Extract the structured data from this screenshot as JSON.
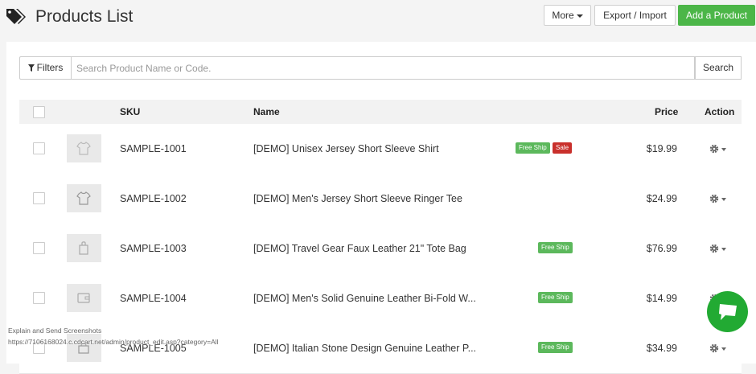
{
  "header": {
    "title": "Products List",
    "more_label": "More",
    "export_label": "Export / Import",
    "add_label": "Add a Product"
  },
  "search": {
    "filters_label": "Filters",
    "placeholder": "Search Product Name or Code.",
    "value": "",
    "search_label": "Search"
  },
  "table": {
    "headers": {
      "sku": "SKU",
      "name": "Name",
      "price": "Price",
      "action": "Action"
    },
    "rows": [
      {
        "sku": "SAMPLE-1001",
        "name": "[DEMO] Unisex Jersey Short Sleeve Shirt",
        "price": "$19.99",
        "badges": [
          "Free Ship",
          "Sale"
        ],
        "thumb_icon": "shirt-icon"
      },
      {
        "sku": "SAMPLE-1002",
        "name": "[DEMO] Men's Jersey Short Sleeve Ringer Tee",
        "price": "$24.99",
        "badges": [],
        "thumb_icon": "shirt-icon"
      },
      {
        "sku": "SAMPLE-1003",
        "name": "[DEMO] Travel Gear Faux Leather 21\" Tote Bag",
        "price": "$76.99",
        "badges": [
          "Free Ship"
        ],
        "thumb_icon": "bag-icon"
      },
      {
        "sku": "SAMPLE-1004",
        "name": "[DEMO] Men's Solid Genuine Leather Bi-Fold W...",
        "price": "$14.99",
        "badges": [
          "Free Ship"
        ],
        "thumb_icon": "wallet-icon"
      },
      {
        "sku": "SAMPLE-1005",
        "name": "[DEMO] Italian Stone Design Genuine Leather P...",
        "price": "$34.99",
        "badges": [
          "Free Ship"
        ],
        "thumb_icon": "purse-icon"
      }
    ]
  },
  "status": {
    "line1": "Explain and Send Screenshots",
    "line2": "https://7106168024.c.cdcart.net/admin/product_edit.asp?category=All"
  },
  "colors": {
    "primary_green": "#4cb648",
    "badge_free_ship": "#5cb85c",
    "badge_sale": "#c9302c",
    "chat_green": "#22aa33"
  }
}
